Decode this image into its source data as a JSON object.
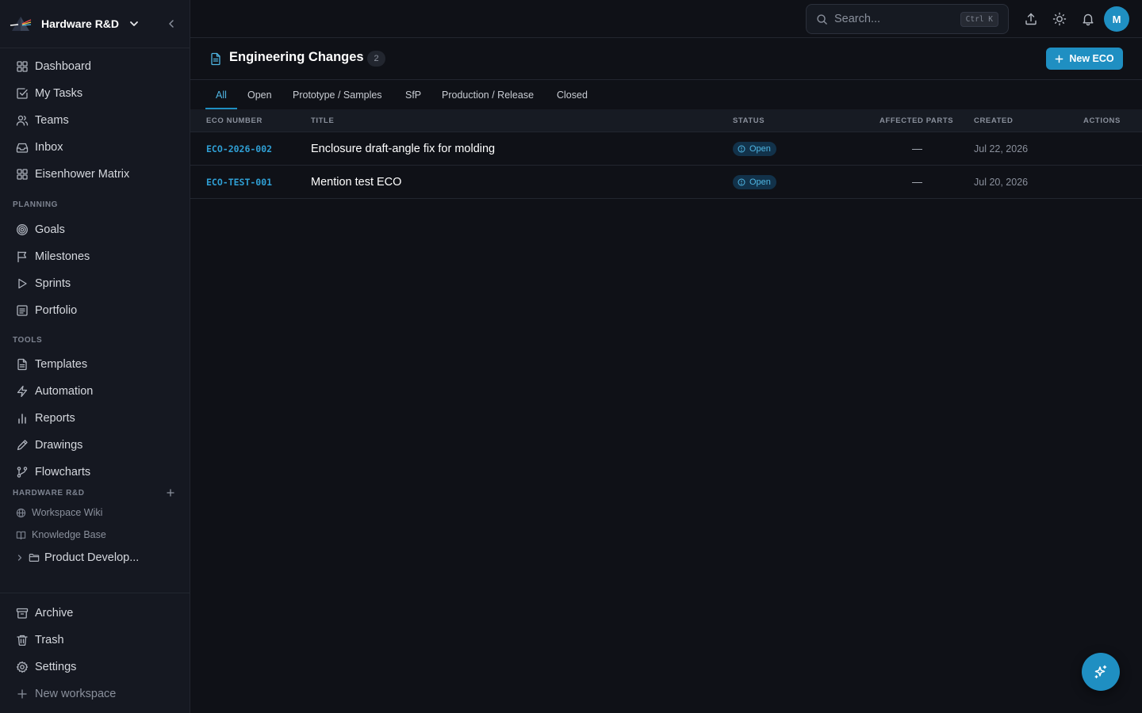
{
  "colors": {
    "accent": "#1f8fc2",
    "accent_text": "#4fb6e3",
    "background": "#0f1117",
    "sidebar": "#151821"
  },
  "workspace": {
    "name": "Hardware R&D"
  },
  "sidebar": {
    "main_items": [
      {
        "label": "Dashboard",
        "icon": "dashboard-icon"
      },
      {
        "label": "My Tasks",
        "icon": "check-square-icon"
      },
      {
        "label": "Teams",
        "icon": "users-icon"
      },
      {
        "label": "Inbox",
        "icon": "inbox-icon"
      },
      {
        "label": "Eisenhower Matrix",
        "icon": "grid-icon"
      }
    ],
    "planning_label": "PLANNING",
    "planning_items": [
      {
        "label": "Goals",
        "icon": "target-icon"
      },
      {
        "label": "Milestones",
        "icon": "flag-icon"
      },
      {
        "label": "Sprints",
        "icon": "play-icon"
      },
      {
        "label": "Portfolio",
        "icon": "portfolio-icon"
      }
    ],
    "tools_label": "TOOLS",
    "tools_items": [
      {
        "label": "Templates",
        "icon": "file-icon"
      },
      {
        "label": "Automation",
        "icon": "zap-icon"
      },
      {
        "label": "Reports",
        "icon": "bar-chart-icon"
      },
      {
        "label": "Drawings",
        "icon": "pencil-icon"
      },
      {
        "label": "Flowcharts",
        "icon": "git-branch-icon"
      }
    ],
    "workspace_section_label": "HARDWARE R&D",
    "workspace_items": [
      {
        "label": "Workspace Wiki",
        "icon": "globe-icon"
      },
      {
        "label": "Knowledge Base",
        "icon": "book-icon"
      }
    ],
    "folder_label": "Product Develop...",
    "bottom_items": [
      {
        "label": "Archive",
        "icon": "archive-icon"
      },
      {
        "label": "Trash",
        "icon": "trash-icon"
      },
      {
        "label": "Settings",
        "icon": "gear-icon"
      }
    ],
    "new_workspace_label": "New workspace"
  },
  "topbar": {
    "search_placeholder": "Search...",
    "search_shortcut": "Ctrl K",
    "avatar_initial": "M"
  },
  "page": {
    "title": "Engineering Changes",
    "count": "2",
    "new_button_label": "New ECO"
  },
  "tabs": [
    {
      "label": "All",
      "active": true
    },
    {
      "label": "Open"
    },
    {
      "label": "Prototype / Samples"
    },
    {
      "label": "SfP"
    },
    {
      "label": "Production / Release"
    },
    {
      "label": "Closed"
    }
  ],
  "table": {
    "columns": [
      "ECO NUMBER",
      "TITLE",
      "STATUS",
      "AFFECTED PARTS",
      "CREATED",
      "ACTIONS"
    ],
    "rows": [
      {
        "eco_number": "ECO-2026-002",
        "title": "Enclosure draft-angle fix for molding",
        "status": "Open",
        "affected_parts": "—",
        "created": "Jul 22, 2026"
      },
      {
        "eco_number": "ECO-TEST-001",
        "title": "Mention test ECO",
        "status": "Open",
        "affected_parts": "—",
        "created": "Jul 20, 2026"
      }
    ]
  }
}
